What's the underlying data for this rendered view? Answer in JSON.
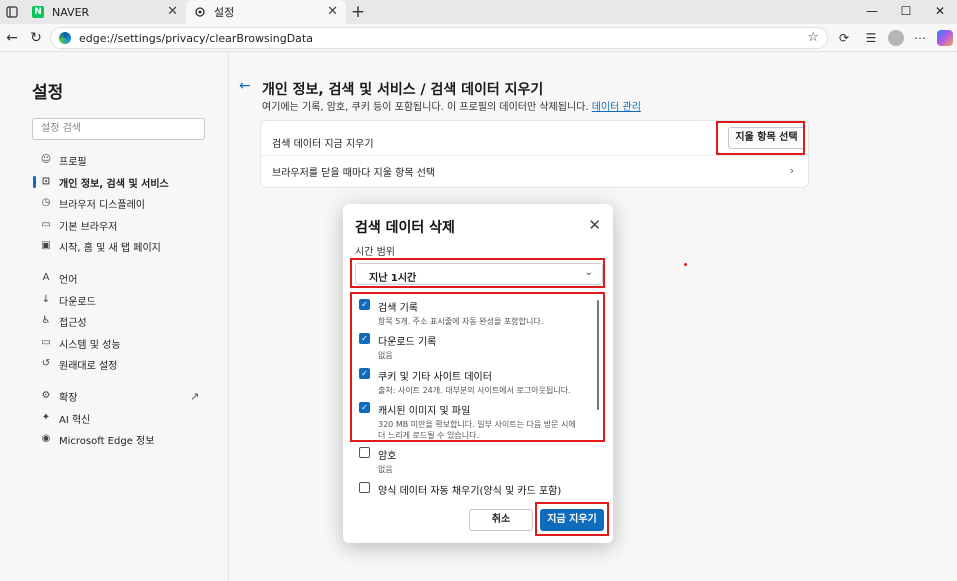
{
  "tabs": [
    {
      "label": "NAVER",
      "favicon": "naver-icon"
    },
    {
      "label": "설정",
      "favicon": "gear-icon"
    }
  ],
  "window_controls": {
    "minimize": "—",
    "maximize": "☐",
    "close": "✕"
  },
  "address_bar": {
    "url": "edge://settings/privacy/clearBrowsingData"
  },
  "sidebar": {
    "title": "설정",
    "search_placeholder": "설정 검색",
    "items": [
      {
        "label": "프로필",
        "icon": "profile-icon"
      },
      {
        "label": "개인 정보, 검색 및 서비스",
        "icon": "lock-icon",
        "active": true
      },
      {
        "label": "브라우저 디스플레이",
        "icon": "display-icon"
      },
      {
        "label": "기본 브라우저",
        "icon": "browser-icon"
      },
      {
        "label": "시작, 홈 및 새 탭 페이지",
        "icon": "home-icon"
      },
      {
        "label": "언어",
        "icon": "language-icon"
      },
      {
        "label": "다운로드",
        "icon": "download-icon"
      },
      {
        "label": "접근성",
        "icon": "accessibility-icon"
      },
      {
        "label": "시스템 및 성능",
        "icon": "system-icon"
      },
      {
        "label": "원래대로 설정",
        "icon": "reset-icon"
      },
      {
        "label": "확장",
        "icon": "extensions-icon"
      },
      {
        "label": "AI 혁신",
        "icon": "ai-icon"
      },
      {
        "label": "Microsoft Edge 정보",
        "icon": "edge-icon"
      }
    ]
  },
  "main": {
    "title": "개인 정보, 검색 및 서비스 / 검색 데이터 지우기",
    "subtitle": "여기에는 기록, 암호, 쿠키 등이 포함됩니다. 이 프로필의 데이터만 삭제됩니다.",
    "subtitle_link": "데이터 관리",
    "row1_label": "검색 데이터 지금 지우기",
    "row1_button": "지울 항목 선택",
    "row2_label": "브라우저를 닫을 때마다 지울 항목 선택"
  },
  "dialog": {
    "title": "검색 데이터 삭제",
    "time_range_label": "시간 범위",
    "time_range_value": "지난 1시간",
    "options": [
      {
        "label": "검색 기록",
        "desc": "항목 5개. 주소 표시줄에 자동 완성을 포함합니다.",
        "checked": true
      },
      {
        "label": "다운로드 기록",
        "desc": "없음",
        "checked": true
      },
      {
        "label": "쿠키 및 기타 사이트 데이터",
        "desc": "출처: 사이트 24개. 대부분의 사이트에서 로그아웃됩니다.",
        "checked": true
      },
      {
        "label": "캐시된 이미지 및 파일",
        "desc": "320 MB 미만을 확보합니다. 일부 사이트는 다음 방문 시에 더 느리게 로드될 수 있습니다.",
        "checked": true
      },
      {
        "label": "암호",
        "desc": "없음",
        "checked": false
      },
      {
        "label": "양식 데이터 자동 채우기(양식 및 카드 포함)",
        "desc": "",
        "checked": false
      }
    ],
    "cancel_label": "취소",
    "clear_label": "지금 지우기"
  },
  "colors": {
    "accent": "#0f6cbd",
    "highlight": "#e01919"
  }
}
